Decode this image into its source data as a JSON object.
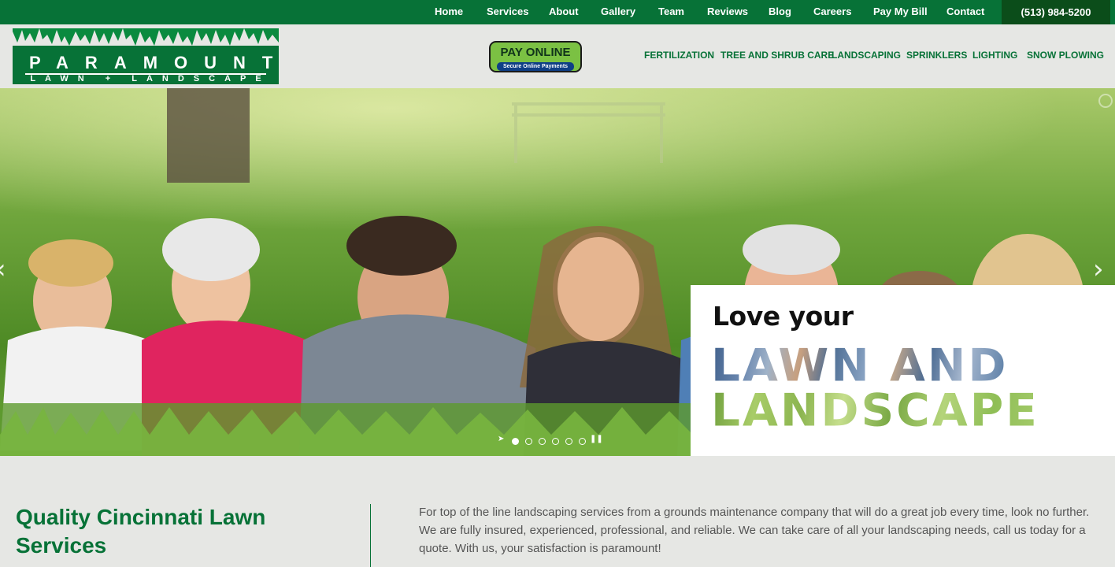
{
  "topnav": {
    "items": [
      {
        "label": "Home"
      },
      {
        "label": "Services"
      },
      {
        "label": "About"
      },
      {
        "label": "Gallery"
      },
      {
        "label": "Team"
      },
      {
        "label": "Reviews"
      },
      {
        "label": "Blog"
      },
      {
        "label": "Careers"
      },
      {
        "label": "Pay My Bill"
      },
      {
        "label": "Contact"
      }
    ],
    "phone": "(513) 984-5200"
  },
  "logo": {
    "name": "PARAMOUNT",
    "sub": "LAWN + LANDSCAPE"
  },
  "pay_online": {
    "label": "PAY ONLINE",
    "sub": "Secure Online Payments"
  },
  "services_nav": {
    "items": [
      {
        "label": "FERTILIZATION"
      },
      {
        "label": "TREE AND SHRUB CARE"
      },
      {
        "label": "LANDSCAPING"
      },
      {
        "label": "SPRINKLERS"
      },
      {
        "label": "LIGHTING"
      },
      {
        "label": "SNOW PLOWING"
      }
    ]
  },
  "hero": {
    "heading_small": "Love your",
    "heading_line1": "LAWN AND",
    "heading_line2": "LANDSCAPE",
    "slides_count": 6,
    "active_slide": 1
  },
  "intro": {
    "title": "Quality Cincinnati Lawn Services",
    "body": "For top of the line landscaping services from a grounds maintenance company that will do a great job every time, look no further. We are fully insured, experienced, professional, and reliable. We can take care of all your landscaping needs, call us today for a quote. With us, your satisfaction is paramount!"
  },
  "colors": {
    "brand_green": "#077237",
    "dark_green": "#0b4d1a",
    "pay_green": "#7bc143",
    "pay_blue": "#0f3f86",
    "page_bg": "#e6e7e4"
  }
}
